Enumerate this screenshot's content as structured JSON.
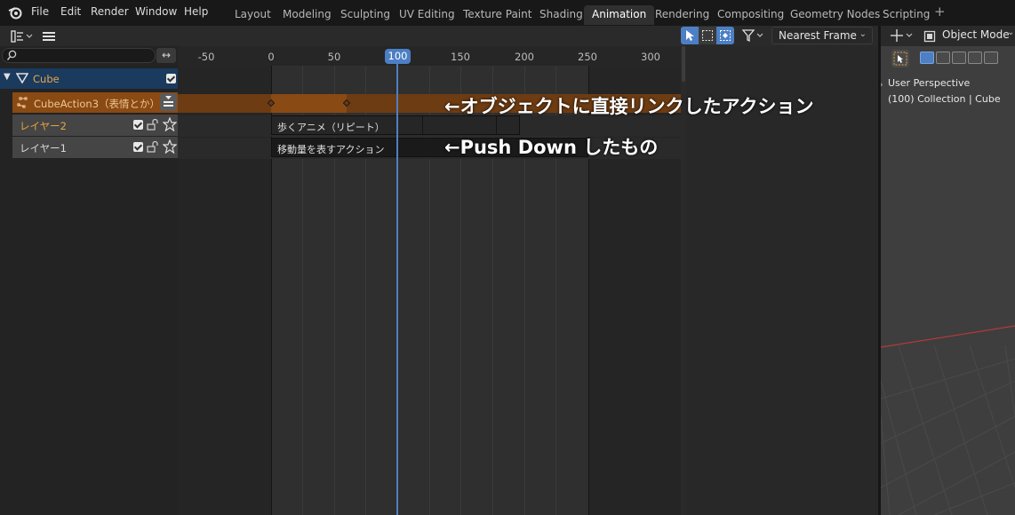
{
  "menubar": {
    "items": [
      "File",
      "Edit",
      "Render",
      "Window",
      "Help"
    ],
    "workspaces": [
      "Layout",
      "Modeling",
      "Sculpting",
      "UV Editing",
      "Texture Paint",
      "Shading",
      "Animation",
      "Rendering",
      "Compositing",
      "Geometry Nodes",
      "Scripting"
    ],
    "active_workspace": "Animation",
    "add_tab": "+"
  },
  "nla_header": {
    "snap_mode": "Nearest Frame"
  },
  "channels": {
    "search_placeholder": "",
    "swap_glyph": "↔",
    "object_name": "Cube",
    "action_name": "CubeAction3（表情とか）",
    "tracks": [
      {
        "name": "レイヤー2",
        "color": "#e8a542"
      },
      {
        "name": "レイヤー1",
        "color": "#d8d8d8"
      }
    ]
  },
  "timeline": {
    "ticks": [
      "-50",
      "0",
      "50",
      "100",
      "150",
      "200",
      "250",
      "300"
    ],
    "current_frame": "100",
    "strips": [
      {
        "label": "歩くアニメ（リピート）"
      },
      {
        "label": "移動量を表すアクション"
      }
    ]
  },
  "annotations": {
    "action_note": "←オブジェクトに直接リンクしたアクション",
    "pushdown_note": "←Push Down したもの"
  },
  "viewport": {
    "mode": "Object Mode",
    "view_name": "User Perspective",
    "collection_info": "(100) Collection | Cube"
  },
  "colors": {
    "accent": "#4c7fc4",
    "action_row": "#8a4a14",
    "object_row": "#1a3a5e",
    "track_row": "#454545"
  }
}
